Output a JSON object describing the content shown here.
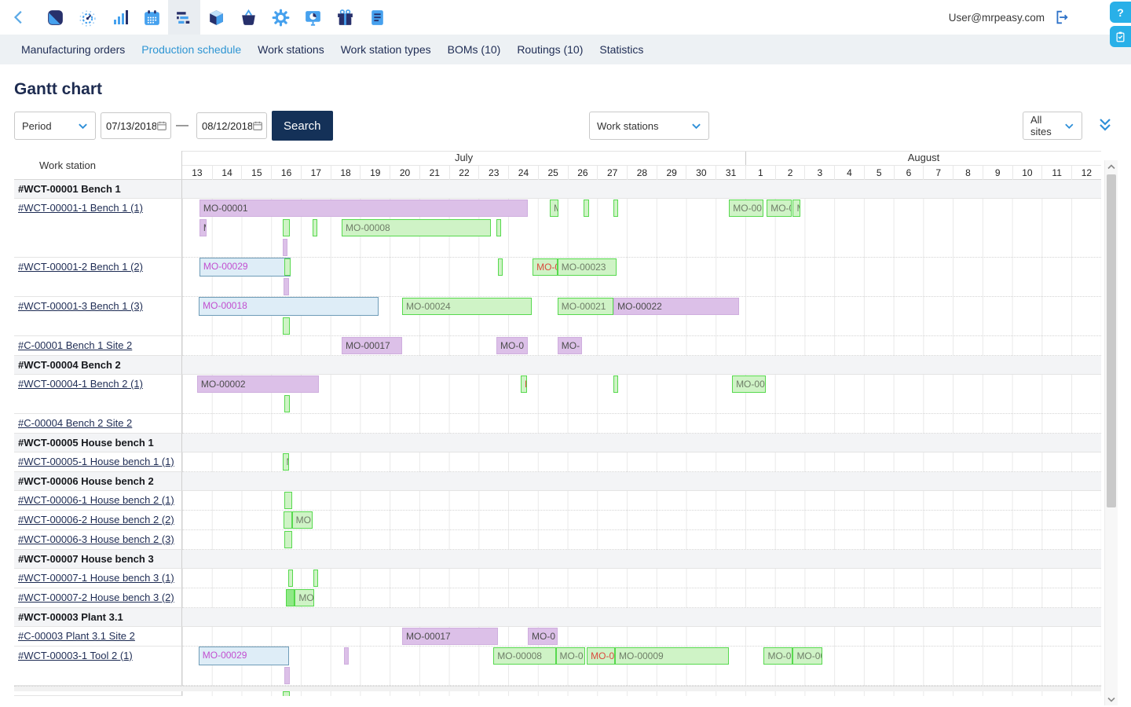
{
  "toolbar": {
    "user_email": "User@mrpeasy.com",
    "icons": [
      "back-chevron",
      "app-logo",
      "gauge",
      "bar-chart",
      "calendar",
      "gantt-selected",
      "cube",
      "basket",
      "gear",
      "presentation",
      "gift",
      "document-card"
    ],
    "logout_icon": "logout-arrow"
  },
  "float_buttons": {
    "help_label": "?",
    "icons": [
      "question-circle",
      "clipboard-check"
    ]
  },
  "nav": {
    "tabs": [
      {
        "label": "Manufacturing orders",
        "active": false
      },
      {
        "label": "Production schedule",
        "active": true
      },
      {
        "label": "Work stations",
        "active": false
      },
      {
        "label": "Work station types",
        "active": false
      },
      {
        "label": "BOMs (10)",
        "active": false
      },
      {
        "label": "Routings (10)",
        "active": false
      },
      {
        "label": "Statistics",
        "active": false
      }
    ]
  },
  "page": {
    "title": "Gantt chart"
  },
  "filters": {
    "period_label": "Period",
    "date_from": "07/13/2018",
    "date_to": "08/12/2018",
    "range_dash": "—",
    "search_label": "Search",
    "group_by_value": "Work stations",
    "site_value": "All sites"
  },
  "colors": {
    "accent_blue": "#2e95d3",
    "navy": "#1e2c54",
    "search_button": "#143158",
    "help_button": "#29b0e8",
    "bar_purple": "#dcc0e8",
    "bar_green": "#cff3c6",
    "bar_green_border": "#57d94e",
    "bar_blue": "#deedf7",
    "label_red": "#da4a3e",
    "label_magenta": "#c24fd0"
  },
  "gantt": {
    "left_header": "Work station",
    "day_width": 37.74,
    "months": [
      {
        "name": "July",
        "days": [
          13,
          14,
          15,
          16,
          17,
          18,
          19,
          20,
          21,
          22,
          23,
          24,
          25,
          26,
          27,
          28,
          29,
          30,
          31
        ]
      },
      {
        "name": "August",
        "days": [
          1,
          2,
          3,
          4,
          5,
          6,
          7,
          8,
          9,
          10,
          11,
          12
        ]
      }
    ],
    "rows": [
      {
        "kind": "group",
        "label": "#WCT-00001 Bench 1"
      },
      {
        "kind": "station",
        "label": "#WCT-00001-1 Bench 1 (1)",
        "lanes": 3,
        "bars": [
          {
            "lane": 0,
            "start": 0.58,
            "end": 11.65,
            "color": "purple",
            "label": "MO-00001"
          },
          {
            "lane": 0,
            "start": 12.4,
            "end": 12.7,
            "color": "green",
            "label": "M"
          },
          {
            "lane": 0,
            "start": 13.55,
            "end": 13.72,
            "color": "green",
            "label": ""
          },
          {
            "lane": 0,
            "start": 14.56,
            "end": 14.64,
            "color": "green",
            "label": ""
          },
          {
            "lane": 0,
            "start": 18.45,
            "end": 19.6,
            "color": "green",
            "label": "MO-00"
          },
          {
            "lane": 0,
            "start": 19.72,
            "end": 20.55,
            "color": "green",
            "label": "MO-0"
          },
          {
            "lane": 0,
            "start": 20.6,
            "end": 20.85,
            "color": "green",
            "label": "M"
          },
          {
            "lane": 1,
            "start": 0.58,
            "end": 0.82,
            "color": "purple",
            "label": "M"
          },
          {
            "lane": 1,
            "start": 3.4,
            "end": 3.62,
            "color": "green",
            "label": ""
          },
          {
            "lane": 1,
            "start": 4.4,
            "end": 4.52,
            "color": "green",
            "label": ""
          },
          {
            "lane": 1,
            "start": 5.38,
            "end": 10.42,
            "color": "green",
            "label": "MO-00008"
          },
          {
            "lane": 1,
            "start": 10.6,
            "end": 10.73,
            "color": "green",
            "label": ""
          },
          {
            "lane": 2,
            "start": 3.4,
            "end": 3.56,
            "color": "purple",
            "label": ""
          }
        ]
      },
      {
        "kind": "station",
        "label": "#WCT-00001-2 Bench 1 (2)",
        "lanes": 2,
        "bars": [
          {
            "lane": 0,
            "start": 0.58,
            "end": 3.66,
            "color": "blue",
            "label": "MO-00029"
          },
          {
            "lane": 0,
            "start": 3.45,
            "end": 3.66,
            "color": "green",
            "label": ""
          },
          {
            "lane": 0,
            "start": 10.65,
            "end": 10.78,
            "color": "green",
            "label": ""
          },
          {
            "lane": 0,
            "start": 11.82,
            "end": 12.66,
            "color": "green",
            "label": "MO-0",
            "label_color": "red"
          },
          {
            "lane": 0,
            "start": 12.66,
            "end": 14.65,
            "color": "green",
            "label": "MO-00023"
          },
          {
            "lane": 1,
            "start": 3.42,
            "end": 3.6,
            "color": "purple",
            "label": "M"
          }
        ]
      },
      {
        "kind": "station",
        "label": "#WCT-00001-3 Bench 1 (3)",
        "lanes": 2,
        "bars": [
          {
            "lane": 0,
            "start": 0.56,
            "end": 6.62,
            "color": "blue",
            "label": "MO-00018"
          },
          {
            "lane": 0,
            "start": 7.42,
            "end": 11.8,
            "color": "green",
            "label": "MO-00024"
          },
          {
            "lane": 0,
            "start": 12.66,
            "end": 14.55,
            "color": "green",
            "label": "MO-00021"
          },
          {
            "lane": 0,
            "start": 14.55,
            "end": 18.78,
            "color": "purple",
            "label": "MO-00022"
          },
          {
            "lane": 1,
            "start": 3.4,
            "end": 3.62,
            "color": "green",
            "label": ""
          }
        ]
      },
      {
        "kind": "station",
        "label": "#C-00001 Bench 1 Site 2",
        "lanes": 1,
        "bars": [
          {
            "lane": 0,
            "start": 5.38,
            "end": 7.42,
            "color": "purple",
            "label": "MO-00017"
          },
          {
            "lane": 0,
            "start": 10.6,
            "end": 11.66,
            "color": "purple",
            "label": "MO-0"
          },
          {
            "lane": 0,
            "start": 12.66,
            "end": 13.5,
            "color": "purple",
            "label": "MO-"
          }
        ]
      },
      {
        "kind": "group",
        "label": "#WCT-00004 Bench 2"
      },
      {
        "kind": "station",
        "label": "#WCT-00004-1 Bench 2 (1)",
        "lanes": 2,
        "bars": [
          {
            "lane": 0,
            "start": 0.5,
            "end": 4.6,
            "color": "purple",
            "label": "MO-00002"
          },
          {
            "lane": 0,
            "start": 11.42,
            "end": 11.62,
            "color": "green",
            "label": "M",
            "label_color": "red"
          },
          {
            "lane": 0,
            "start": 14.56,
            "end": 14.64,
            "color": "green",
            "label": ""
          },
          {
            "lane": 0,
            "start": 18.55,
            "end": 19.7,
            "color": "green",
            "label": "MO-00"
          },
          {
            "lane": 1,
            "start": 3.45,
            "end": 3.62,
            "color": "green",
            "label": ""
          }
        ]
      },
      {
        "kind": "station",
        "label": "#C-00004 Bench 2 Site 2",
        "lanes": 1,
        "bars": []
      },
      {
        "kind": "group",
        "label": "#WCT-00005 House bench 1"
      },
      {
        "kind": "station",
        "label": "#WCT-00005-1 House bench 1 (1)",
        "lanes": 1,
        "bars": [
          {
            "lane": 0,
            "start": 3.38,
            "end": 3.6,
            "color": "green",
            "label": "M"
          }
        ]
      },
      {
        "kind": "group",
        "label": "#WCT-00006 House bench 2"
      },
      {
        "kind": "station",
        "label": "#WCT-00006-1 House bench 2 (1)",
        "lanes": 1,
        "bars": [
          {
            "lane": 0,
            "start": 3.45,
            "end": 3.72,
            "color": "green",
            "label": ""
          }
        ]
      },
      {
        "kind": "station",
        "label": "#WCT-00006-2 House bench 2 (2)",
        "lanes": 1,
        "bars": [
          {
            "lane": 0,
            "start": 3.42,
            "end": 3.7,
            "color": "green",
            "label": ""
          },
          {
            "lane": 0,
            "start": 3.7,
            "end": 4.4,
            "color": "green",
            "label": "MO"
          }
        ]
      },
      {
        "kind": "station",
        "label": "#WCT-00006-3 House bench 2 (3)",
        "lanes": 1,
        "bars": [
          {
            "lane": 0,
            "start": 3.45,
            "end": 3.72,
            "color": "green",
            "label": ""
          }
        ]
      },
      {
        "kind": "group",
        "label": "#WCT-00007 House bench 3"
      },
      {
        "kind": "station",
        "label": "#WCT-00007-1 House bench 3 (1)",
        "lanes": 1,
        "bars": [
          {
            "lane": 0,
            "start": 3.58,
            "end": 3.68,
            "color": "green",
            "label": ""
          },
          {
            "lane": 0,
            "start": 4.42,
            "end": 4.52,
            "color": "green",
            "label": ""
          }
        ]
      },
      {
        "kind": "station",
        "label": "#WCT-00007-2 House bench 3 (2)",
        "lanes": 1,
        "bars": [
          {
            "lane": 0,
            "start": 3.5,
            "end": 3.8,
            "color": "green_dark",
            "label": ""
          },
          {
            "lane": 0,
            "start": 3.8,
            "end": 4.45,
            "color": "green",
            "label": "MO"
          }
        ]
      },
      {
        "kind": "group",
        "label": "#WCT-00003 Plant 3.1"
      },
      {
        "kind": "station",
        "label": "#C-00003 Plant 3.1 Site 2",
        "lanes": 1,
        "bars": [
          {
            "lane": 0,
            "start": 7.42,
            "end": 10.65,
            "color": "purple",
            "label": "MO-00017"
          },
          {
            "lane": 0,
            "start": 11.66,
            "end": 12.66,
            "color": "purple",
            "label": "MO-0"
          }
        ]
      },
      {
        "kind": "station",
        "label": "#WCT-00003-1 Tool 2 (1)",
        "lanes": 2,
        "bars": [
          {
            "lane": 0,
            "start": 0.55,
            "end": 3.6,
            "color": "blue",
            "label": "MO-00029"
          },
          {
            "lane": 0,
            "start": 5.45,
            "end": 5.53,
            "color": "purple",
            "label": ""
          },
          {
            "lane": 0,
            "start": 10.5,
            "end": 12.6,
            "color": "green",
            "label": "MO-00008"
          },
          {
            "lane": 0,
            "start": 12.6,
            "end": 13.6,
            "color": "green",
            "label": "MO-0"
          },
          {
            "lane": 0,
            "start": 13.65,
            "end": 14.6,
            "color": "green",
            "label": "MO-0",
            "label_color": "red"
          },
          {
            "lane": 0,
            "start": 14.6,
            "end": 18.45,
            "color": "green",
            "label": "MO-00009"
          },
          {
            "lane": 0,
            "start": 19.62,
            "end": 20.6,
            "color": "green",
            "label": "MO-0"
          },
          {
            "lane": 0,
            "start": 20.6,
            "end": 21.6,
            "color": "green",
            "label": "MO-00"
          },
          {
            "lane": 1,
            "start": 3.45,
            "end": 3.62,
            "color": "purple",
            "label": "M"
          }
        ]
      },
      {
        "kind": "strip"
      },
      {
        "kind": "partial",
        "bars": [
          {
            "lane": 0,
            "start": 3.4,
            "end": 3.62,
            "color": "green",
            "label": ""
          }
        ]
      }
    ]
  }
}
